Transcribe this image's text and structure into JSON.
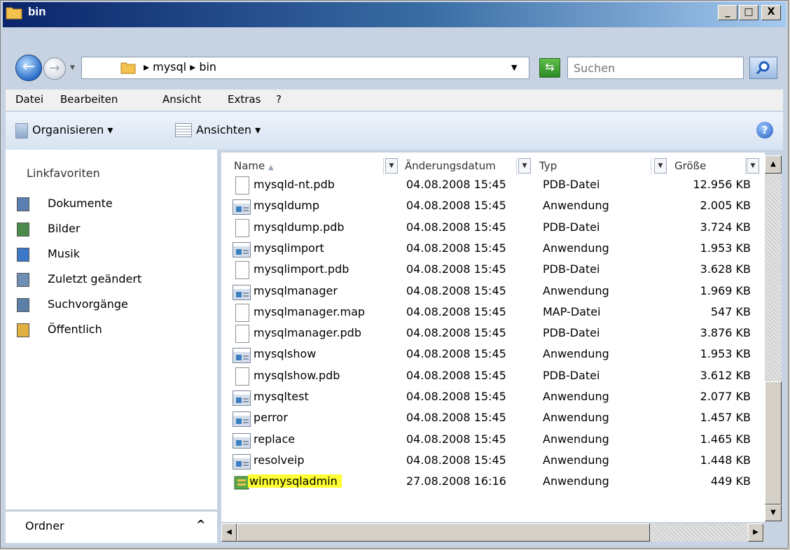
{
  "window": {
    "title": "bin",
    "caption_buttons": {
      "minimize": "_",
      "maximize": "□",
      "close": "X"
    }
  },
  "address": {
    "crumbs": "▸ mysql ▸ bin",
    "search_placeholder": "Suchen"
  },
  "menu": [
    "Datei",
    "Bearbeiten",
    "Ansicht",
    "Extras",
    "?"
  ],
  "toolbar": {
    "organize": "Organisieren ▾",
    "views": "Ansichten ▾"
  },
  "nav": {
    "header": "Linkfavoriten",
    "items": [
      {
        "label": "Dokumente",
        "icon": "documents-icon",
        "color": "#5a7fb0"
      },
      {
        "label": "Bilder",
        "icon": "pictures-icon",
        "color": "#4a8a4a"
      },
      {
        "label": "Musik",
        "icon": "music-icon",
        "color": "#3b78c8"
      },
      {
        "label": "Zuletzt geändert",
        "icon": "recent-icon",
        "color": "#6f8fb5"
      },
      {
        "label": "Suchvorgänge",
        "icon": "searches-icon",
        "color": "#5c7fa8"
      },
      {
        "label": "Öffentlich",
        "icon": "public-folder-icon",
        "color": "#e0b040"
      }
    ],
    "folders_label": "Ordner"
  },
  "columns": [
    "Name",
    "Änderungsdatum",
    "Typ",
    "Größe"
  ],
  "sort_indicator": "▲",
  "files": [
    {
      "name": "mysqld-nt.pdb",
      "date": "04.08.2008 15:45",
      "type": "PDB-Datei",
      "size": "12.956 KB",
      "kind": "doc"
    },
    {
      "name": "mysqldump",
      "date": "04.08.2008 15:45",
      "type": "Anwendung",
      "size": "2.005 KB",
      "kind": "exe"
    },
    {
      "name": "mysqldump.pdb",
      "date": "04.08.2008 15:45",
      "type": "PDB-Datei",
      "size": "3.724 KB",
      "kind": "doc"
    },
    {
      "name": "mysqlimport",
      "date": "04.08.2008 15:45",
      "type": "Anwendung",
      "size": "1.953 KB",
      "kind": "exe"
    },
    {
      "name": "mysqlimport.pdb",
      "date": "04.08.2008 15:45",
      "type": "PDB-Datei",
      "size": "3.628 KB",
      "kind": "doc"
    },
    {
      "name": "mysqlmanager",
      "date": "04.08.2008 15:45",
      "type": "Anwendung",
      "size": "1.969 KB",
      "kind": "exe"
    },
    {
      "name": "mysqlmanager.map",
      "date": "04.08.2008 15:45",
      "type": "MAP-Datei",
      "size": "547 KB",
      "kind": "doc"
    },
    {
      "name": "mysqlmanager.pdb",
      "date": "04.08.2008 15:45",
      "type": "PDB-Datei",
      "size": "3.876 KB",
      "kind": "doc"
    },
    {
      "name": "mysqlshow",
      "date": "04.08.2008 15:45",
      "type": "Anwendung",
      "size": "1.953 KB",
      "kind": "exe"
    },
    {
      "name": "mysqlshow.pdb",
      "date": "04.08.2008 15:45",
      "type": "PDB-Datei",
      "size": "3.612 KB",
      "kind": "doc"
    },
    {
      "name": "mysqltest",
      "date": "04.08.2008 15:45",
      "type": "Anwendung",
      "size": "2.077 KB",
      "kind": "exe"
    },
    {
      "name": "perror",
      "date": "04.08.2008 15:45",
      "type": "Anwendung",
      "size": "1.457 KB",
      "kind": "exe"
    },
    {
      "name": "replace",
      "date": "04.08.2008 15:45",
      "type": "Anwendung",
      "size": "1.465 KB",
      "kind": "exe"
    },
    {
      "name": "resolveip",
      "date": "04.08.2008 15:45",
      "type": "Anwendung",
      "size": "1.448 KB",
      "kind": "exe"
    },
    {
      "name": "winmysqladmin",
      "date": "27.08.2008 16:16",
      "type": "Anwendung",
      "size": "449 KB",
      "kind": "app",
      "highlight": "#ffff33"
    }
  ],
  "help_label": "?"
}
